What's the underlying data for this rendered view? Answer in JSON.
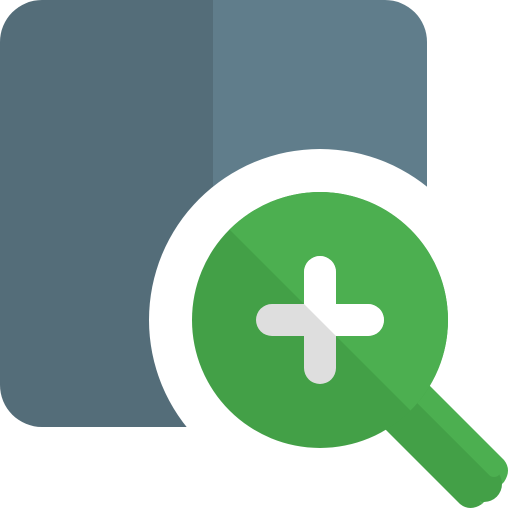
{
  "icon": {
    "name": "zoom-in-icon",
    "parts": [
      "square-panel",
      "magnifier-lens",
      "magnifier-handle",
      "plus-sign"
    ]
  },
  "colors": {
    "background": "#ffffff",
    "panel_dark": "#546d79",
    "panel_light": "#607d8b",
    "outline": "#ffffff",
    "lens_light": "#4caf50",
    "lens_dark": "#43a047",
    "handle_light": "#4caf50",
    "handle_dark": "#43a047",
    "plus_light": "#ffffff",
    "plus_dark": "#dedede"
  }
}
